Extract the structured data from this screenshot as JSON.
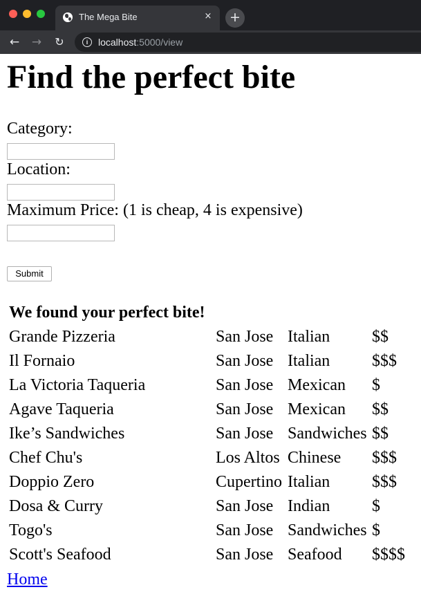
{
  "browser": {
    "tab_title": "The Mega Bite",
    "close_glyph": "×",
    "new_tab_glyph": "+",
    "url_host": "localhost",
    "url_rest": ":5000/view",
    "icons": [
      "back-arrow-icon",
      "forward-arrow-icon",
      "reload-icon",
      "info-icon",
      "globe-favicon-icon"
    ]
  },
  "page": {
    "heading": "Find the perfect bite",
    "form": {
      "category_label": "Category:",
      "category_value": "",
      "location_label": "Location:",
      "location_value": "",
      "max_price_label": "Maximum Price: (1 is cheap, 4 is expensive)",
      "max_price_value": "",
      "submit_label": "Submit"
    },
    "results": {
      "header": "We found your perfect bite!",
      "rows": [
        {
          "name": "Grande Pizzeria",
          "city": "San Jose",
          "cuisine": "Italian",
          "price": "$$"
        },
        {
          "name": "Il Fornaio",
          "city": "San Jose",
          "cuisine": "Italian",
          "price": "$$$"
        },
        {
          "name": "La Victoria Taqueria",
          "city": "San Jose",
          "cuisine": "Mexican",
          "price": "$"
        },
        {
          "name": "Agave Taqueria",
          "city": "San Jose",
          "cuisine": "Mexican",
          "price": "$$"
        },
        {
          "name": "Ike’s Sandwiches",
          "city": "San Jose",
          "cuisine": "Sandwiches",
          "price": "$$"
        },
        {
          "name": "Chef Chu's",
          "city": "Los Altos",
          "cuisine": "Chinese",
          "price": "$$$"
        },
        {
          "name": "Doppio Zero",
          "city": "Cupertino",
          "cuisine": "Italian",
          "price": "$$$"
        },
        {
          "name": "Dosa & Curry",
          "city": "San Jose",
          "cuisine": "Indian",
          "price": "$"
        },
        {
          "name": "Togo's",
          "city": "San Jose",
          "cuisine": "Sandwiches",
          "price": "$"
        },
        {
          "name": "Scott's Seafood",
          "city": "San Jose",
          "cuisine": "Seafood",
          "price": "$$$$"
        }
      ]
    },
    "home_link": "Home"
  },
  "colors": {
    "chrome_dark": "#1f2024",
    "tab_active": "#35363a",
    "link": "#0000ee"
  }
}
